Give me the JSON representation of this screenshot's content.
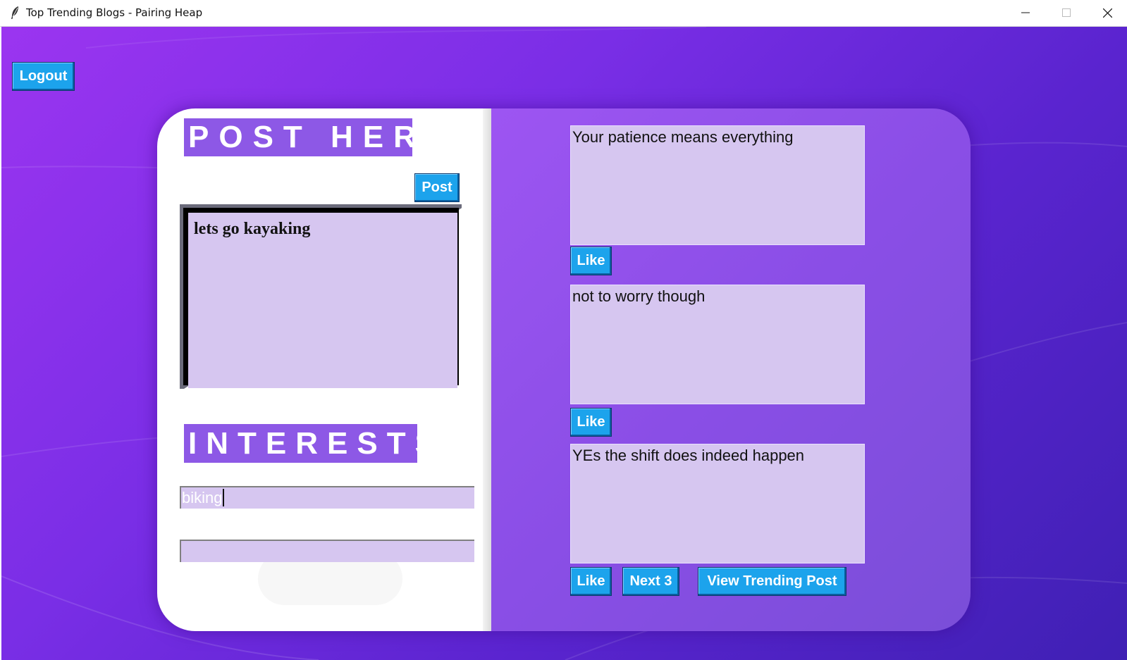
{
  "window": {
    "title": "Top Trending Blogs - Pairing Heap",
    "icon": "feather-icon",
    "controls": [
      "minimize-icon",
      "maximize-icon",
      "close-icon"
    ]
  },
  "toolbar": {
    "logout_label": "Logout"
  },
  "compose": {
    "heading": "POST HERE",
    "post_label": "Post",
    "text": "lets go kayaking"
  },
  "interests": {
    "heading": "INTERESTS",
    "field1_value": "biking",
    "field2_value": ""
  },
  "feed": {
    "posts": [
      {
        "text": "Your patience means everything",
        "like_label": "Like"
      },
      {
        "text": "not to worry though",
        "like_label": "Like"
      },
      {
        "text": "YEs the shift does indeed happen",
        "like_label": "Like"
      }
    ],
    "next_label": "Next 3",
    "trending_label": "View Trending Post"
  },
  "colors": {
    "button": "#1ca3ec",
    "heading": "#8d58e6",
    "field": "#d6c6f0",
    "background_start": "#9b35f0",
    "background_end": "#3f20b4"
  }
}
